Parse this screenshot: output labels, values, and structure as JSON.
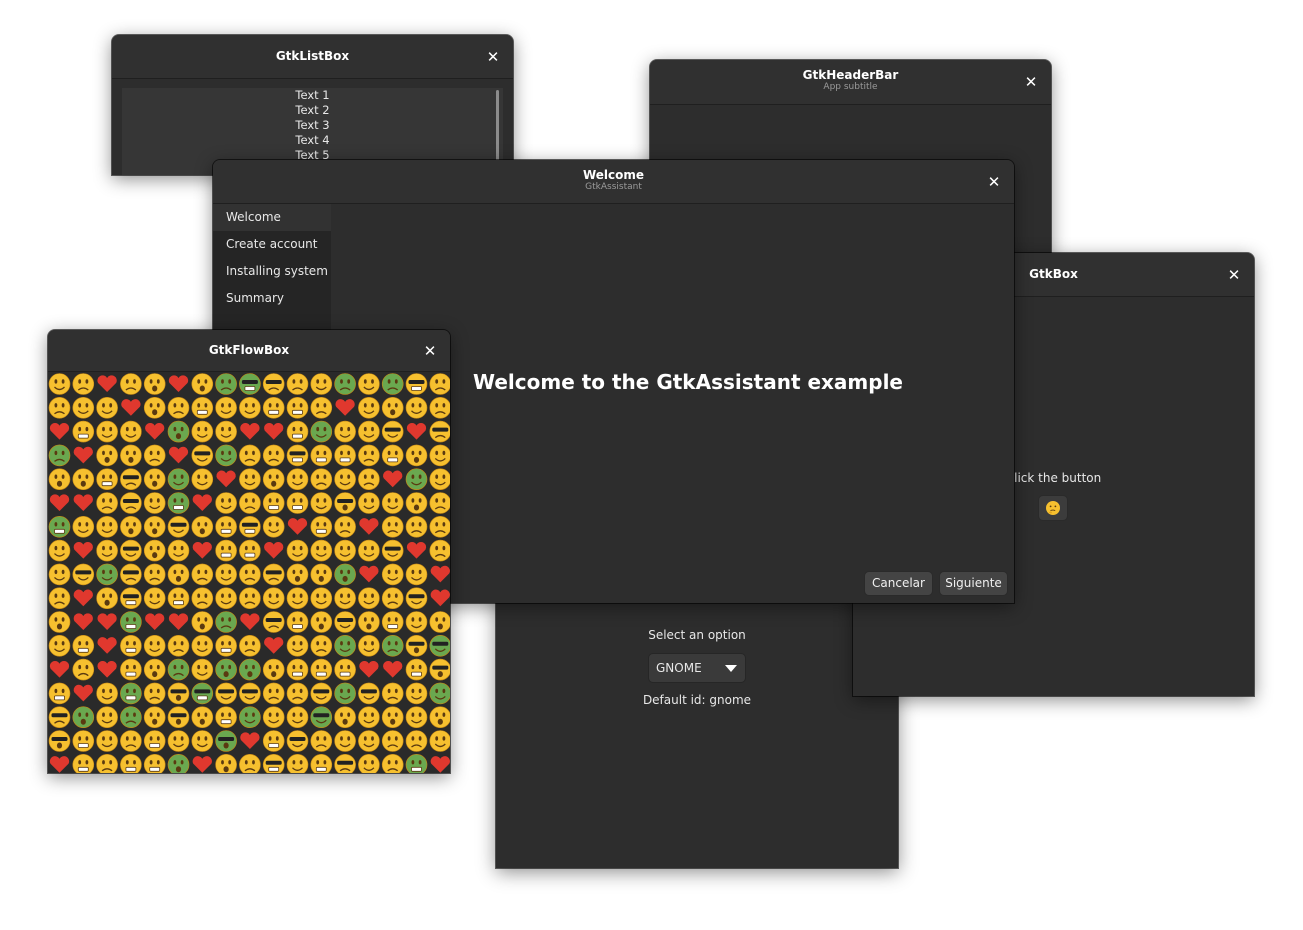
{
  "listbox_window": {
    "title": "GtkListBox",
    "rows": [
      "Text 1",
      "Text 2",
      "Text 3",
      "Text 4",
      "Text 5"
    ]
  },
  "headerbar_window": {
    "title": "GtkHeaderBar",
    "subtitle": "App subtitle"
  },
  "box_window": {
    "title": "GtkBox",
    "label": "Click the button",
    "button_icon": "thinking-face-emoji"
  },
  "dropdown_window": {
    "label": "Select an option",
    "selected": "GNOME",
    "default_text": "Default id: gnome"
  },
  "assistant_window": {
    "title": "Welcome",
    "subtitle": "GtkAssistant",
    "steps": [
      "Welcome",
      "Create account",
      "Installing system",
      "Summary"
    ],
    "active_step": 0,
    "heading": "Welcome to the GtkAssistant example",
    "cancel_label": "Cancelar",
    "next_label": "Siguiente"
  },
  "flowbox_window": {
    "title": "GtkFlowBox",
    "item_kind": "emoji-face"
  },
  "colors": {
    "window_bg": "#2d2d2d",
    "titlebar_bg": "#303030",
    "emoji_yellow": "#f6c02f",
    "emoji_heart": "#e0382e",
    "emoji_sick": "#6aa84f"
  }
}
